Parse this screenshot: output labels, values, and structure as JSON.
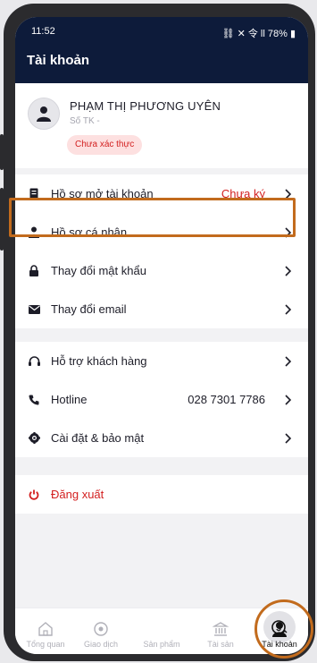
{
  "status": {
    "time": "11:52",
    "right": "⛓ ✕ 令 ll 78% ▮"
  },
  "header": {
    "title": "Tài khoản"
  },
  "profile": {
    "name": "PHẠM THỊ PHƯƠNG UYÊN",
    "account_label": "Số TK -",
    "badge": "Chưa xác thực"
  },
  "menu": {
    "open_account": {
      "label": "Hồ sơ mở tài khoản",
      "value": "Chưa ký"
    },
    "personal": {
      "label": "Hồ sơ cá nhân"
    },
    "password": {
      "label": "Thay đổi mật khẩu"
    },
    "email": {
      "label": "Thay đổi email"
    },
    "support": {
      "label": "Hỗ trợ khách hàng"
    },
    "hotline": {
      "label": "Hotline",
      "value": "028 7301 7786"
    },
    "settings": {
      "label": "Cài đặt & bảo mật"
    },
    "logout": {
      "label": "Đăng xuất"
    }
  },
  "nav": {
    "overview": "Tổng quan",
    "trade": "Giao dịch",
    "products": "Sản phẩm",
    "assets": "Tài sản",
    "account": "Tài khoản"
  },
  "colors": {
    "header_bg": "#0d1b3a",
    "accent_red": "#d32020",
    "highlight": "#c26b1d"
  }
}
